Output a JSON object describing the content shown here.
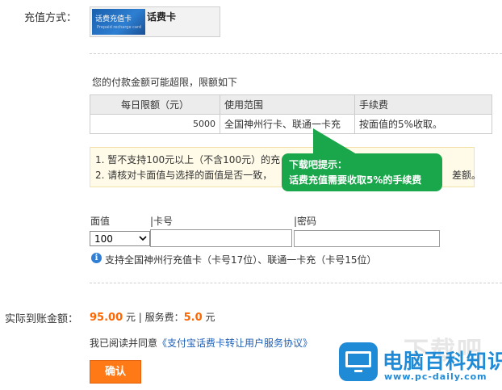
{
  "payment_method": {
    "label": "充值方式：",
    "card_image_text": "话费充值卡",
    "card_image_subtext": "Prepaid recharge card",
    "card_name": "话费卡"
  },
  "limits": {
    "title": "您的付款金额可能超限，限额如下",
    "headers": [
      "每日限额（元）",
      "使用范围",
      "手续费"
    ],
    "rows": [
      [
        "5000",
        "全国神州行卡、联通一卡充",
        "按面值的5%收取。"
      ]
    ]
  },
  "notice": {
    "line1": "1.   暂不支持100元以上（不含100元）的充",
    "line2": "2.   请核对卡面值与选择的面值是否一致，",
    "line2_tail": "差额。"
  },
  "tip_bubble": {
    "title": "下载吧提示：",
    "text": "话费充值需要收取5%的手续费"
  },
  "form": {
    "face_label": "面值",
    "card_label": "|卡号",
    "password_label": "|密码",
    "face_selected": "100",
    "card_value": "",
    "password_value": "",
    "info": "支持全国神州行充值卡（卡号17位）、联通一卡充（卡号15位）"
  },
  "summary": {
    "label": "实际到账金额：",
    "amount": "95.00",
    "unit1": " 元 | 服务费：",
    "fee": "5.0",
    "unit2": " 元"
  },
  "agreement": {
    "prefix": "我已阅读并同意",
    "link": "《支付宝话费卡转让用户服务协议》"
  },
  "confirm_label": "确认",
  "watermark": {
    "top": "下载吧",
    "name": "电脑百科知识",
    "url": "www.pc-daily.com"
  },
  "colors": {
    "accent": "#ff7a16",
    "amount": "#ff6600",
    "tip": "#1aa64a",
    "link": "#1d5fb6"
  }
}
